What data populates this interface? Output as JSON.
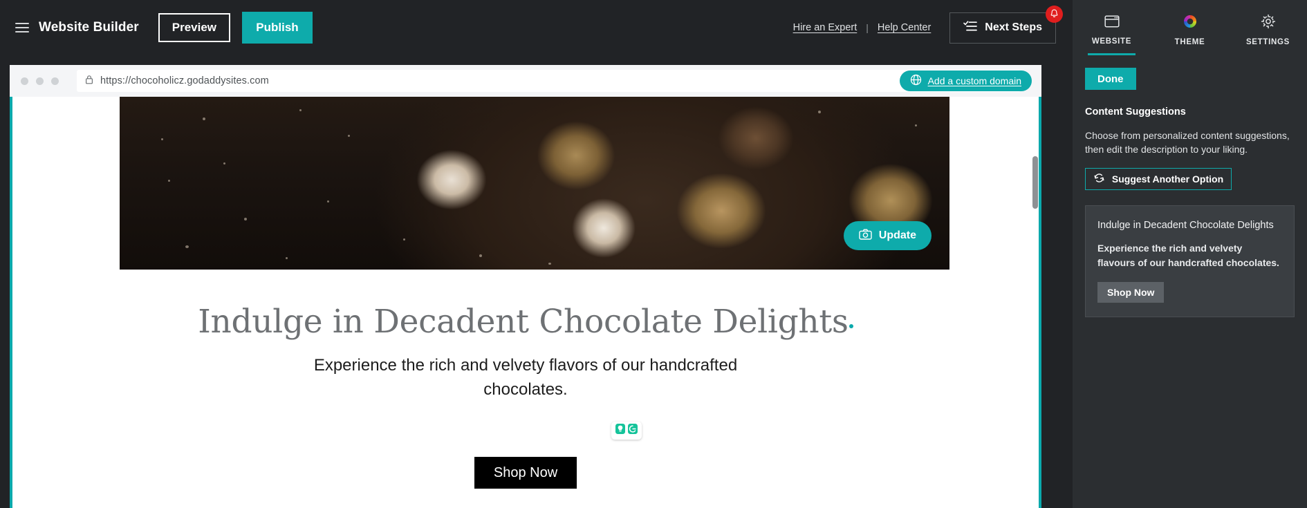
{
  "topbar": {
    "menu_icon": "hamburger-icon",
    "brand": "Website Builder",
    "preview_label": "Preview",
    "publish_label": "Publish",
    "hire_expert_label": "Hire an Expert",
    "separator": "|",
    "help_center_label": "Help Center",
    "next_steps_label": "Next Steps",
    "next_steps_icon": "checklist-icon",
    "notification_icon": "bell-icon"
  },
  "browser": {
    "lock_icon": "lock-icon",
    "url": "https://chocoholicz.godaddysites.com",
    "custom_domain_label": "Add a custom domain",
    "globe_icon": "globe-icon"
  },
  "site": {
    "hero_image_alt": "chocolate-truffles-on-dark-plate",
    "update_label": "Update",
    "update_icon": "camera-icon",
    "heading": "Indulge in Decadent Chocolate Delights",
    "subheading": "Experience the rich and velvety flavors of our handcrafted chocolates.",
    "shop_now_label": "Shop Now",
    "grammarly_icons": [
      "lightbulb-icon",
      "grammarly-logo-icon"
    ]
  },
  "panel": {
    "tabs": [
      {
        "label": "WEBSITE",
        "icon": "browser-window-icon",
        "active": true
      },
      {
        "label": "THEME",
        "icon": "color-wheel-icon",
        "active": false
      },
      {
        "label": "SETTINGS",
        "icon": "gear-icon",
        "active": false
      }
    ],
    "done_label": "Done",
    "section_title": "Content Suggestions",
    "description": "Choose from personalized content suggestions, then edit the description to your liking.",
    "suggest_button_label": "Suggest Another Option",
    "suggest_button_icon": "refresh-icon",
    "suggestion_card": {
      "heading": "Indulge in Decadent Chocolate Delights",
      "body": "Experience the rich and velvety flavours of our handcrafted chocolates.",
      "cta_label": "Shop Now"
    }
  },
  "colors": {
    "accent_teal": "#0eabab",
    "selection_teal": "#0aa9ac",
    "chrome_dark": "#212326",
    "panel_dark": "#2b2e31",
    "badge_red": "#e01e1e"
  }
}
